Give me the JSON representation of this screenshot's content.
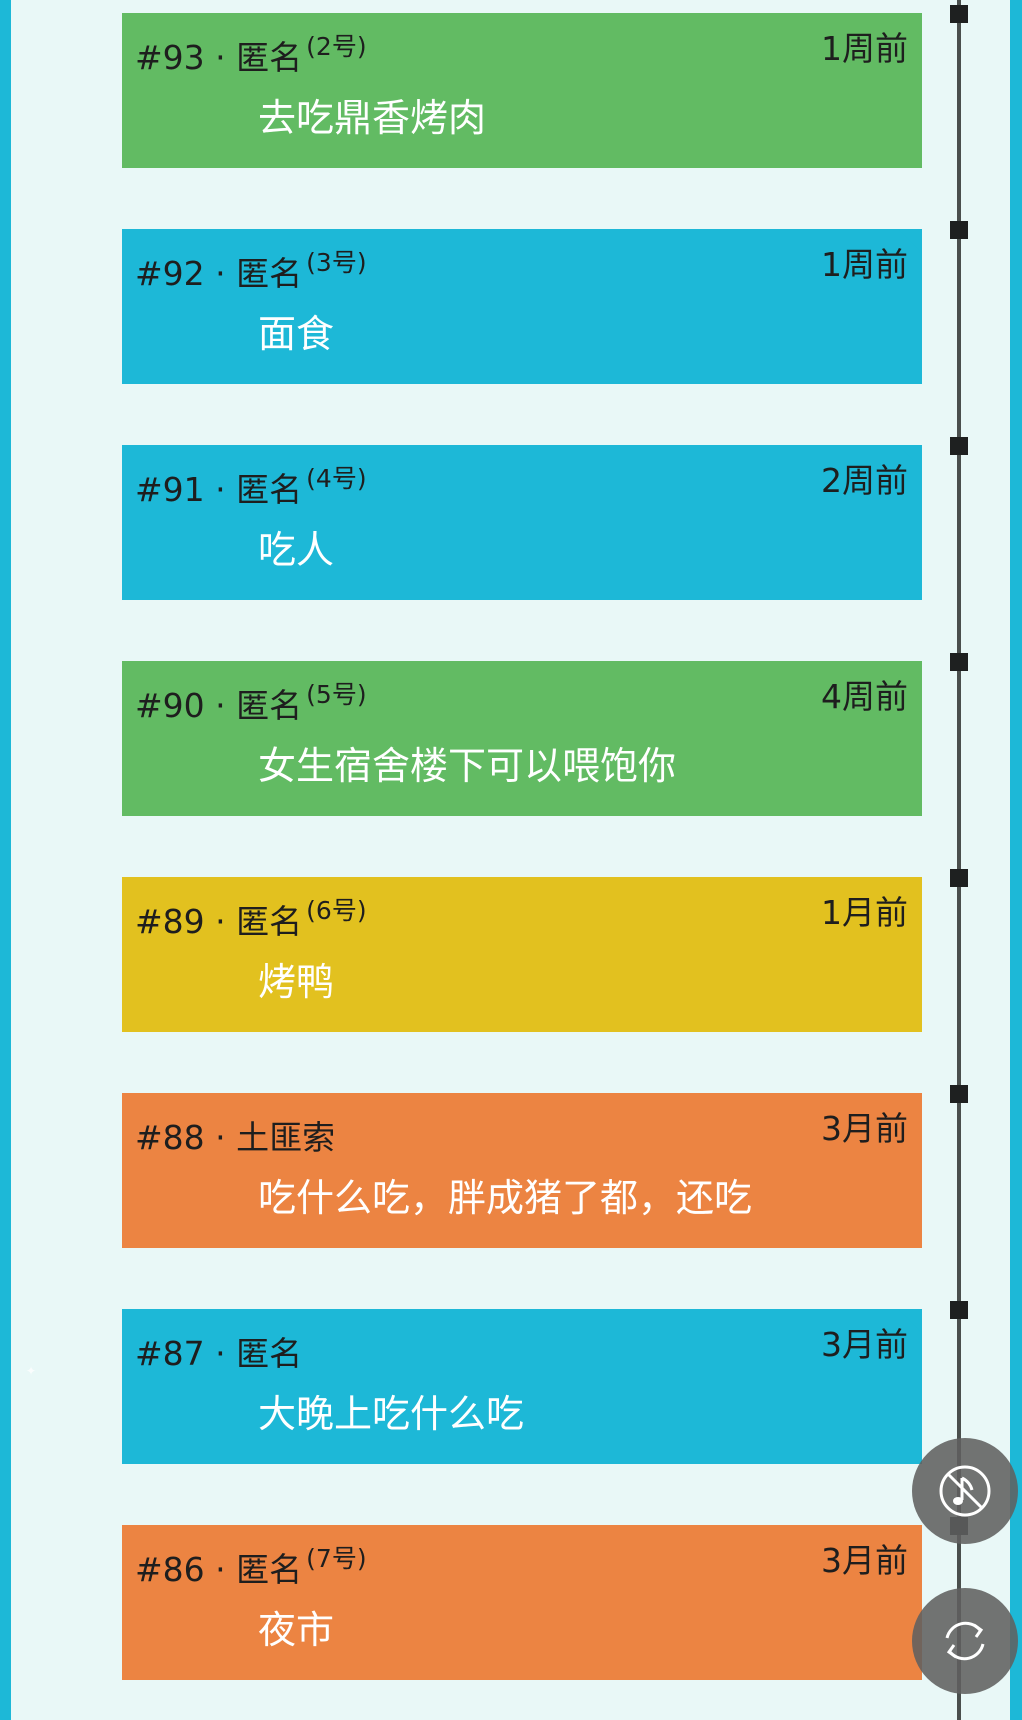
{
  "colors": {
    "green": "#62bb63",
    "blue": "#1db8d7",
    "yellow": "#e2c11f",
    "orange": "#ec8442",
    "timeline": "#4a4f4d",
    "background": "#e9f8f7"
  },
  "posts": [
    {
      "num": "#93",
      "sep": "·",
      "author": "匿名",
      "tag": "(2号)",
      "time": "1周前",
      "text": "去吃鼎香烤肉",
      "color": "green"
    },
    {
      "num": "#92",
      "sep": "·",
      "author": "匿名",
      "tag": "(3号)",
      "time": "1周前",
      "text": "面食",
      "color": "blue"
    },
    {
      "num": "#91",
      "sep": "·",
      "author": "匿名",
      "tag": "(4号)",
      "time": "2周前",
      "text": "吃人",
      "color": "blue"
    },
    {
      "num": "#90",
      "sep": "·",
      "author": "匿名",
      "tag": "(5号)",
      "time": "4周前",
      "text": "女生宿舍楼下可以喂饱你",
      "color": "green"
    },
    {
      "num": "#89",
      "sep": "·",
      "author": "匿名",
      "tag": "(6号)",
      "time": "1月前",
      "text": "烤鸭",
      "color": "yellow"
    },
    {
      "num": "#88",
      "sep": "·",
      "author": "土匪索",
      "tag": "",
      "time": "3月前",
      "text": "吃什么吃，胖成猪了都，还吃",
      "color": "orange"
    },
    {
      "num": "#87",
      "sep": "·",
      "author": "匿名",
      "tag": "",
      "time": "3月前",
      "text": "大晚上吃什么吃",
      "color": "blue"
    },
    {
      "num": "#86",
      "sep": "·",
      "author": "匿名",
      "tag": "(7号)",
      "time": "3月前",
      "text": "夜市",
      "color": "orange"
    }
  ],
  "controls": {
    "music": {
      "icon": "music-off-icon"
    },
    "refresh": {
      "icon": "refresh-icon"
    }
  }
}
